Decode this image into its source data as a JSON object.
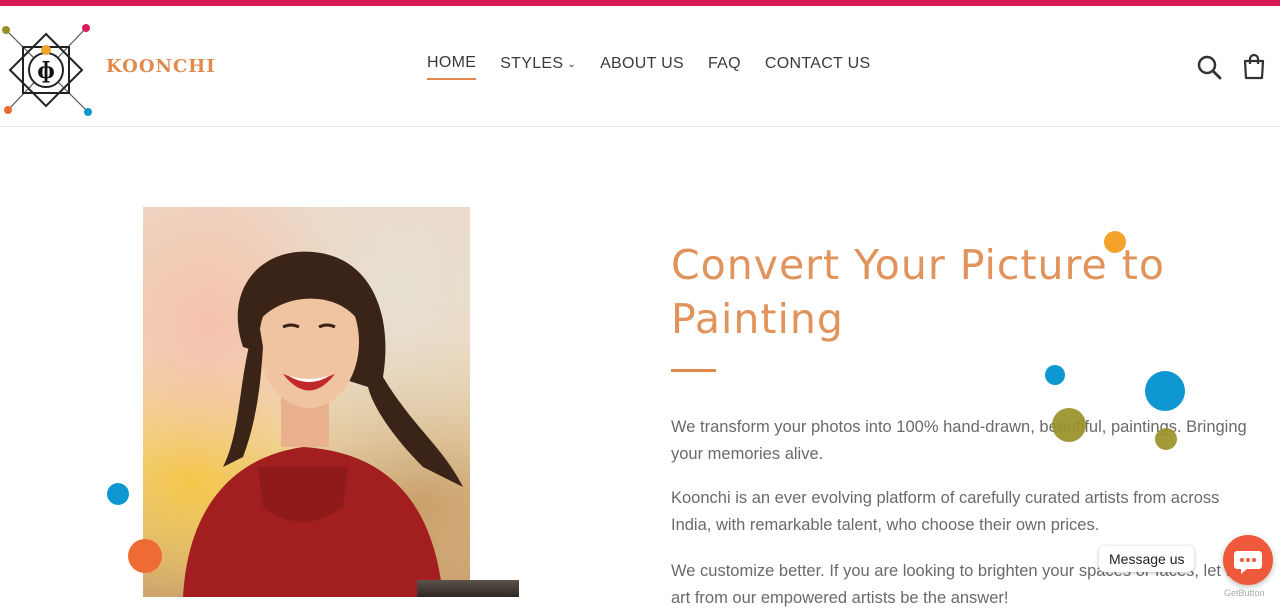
{
  "brand": {
    "name": "KOONCHI",
    "accent": "#e08a4e",
    "topbar_color": "#d81b55"
  },
  "nav": [
    {
      "label": "HOME",
      "active": true
    },
    {
      "label": "STYLES",
      "dropdown": true
    },
    {
      "label": "ABOUT US"
    },
    {
      "label": "FAQ"
    },
    {
      "label": "CONTACT US"
    }
  ],
  "header_icons": [
    "search-icon",
    "cart-icon"
  ],
  "hero": {
    "title": "Convert Your Picture to Painting",
    "paragraphs": [
      "We transform your photos into 100% hand-drawn, beautiful, paintings. Bringing your memories alive.",
      "Koonchi is an ever evolving platform of carefully curated artists from across India, with remarkable talent, who choose their own prices.",
      "We customize better. If you are looking to brighten your spaces or faces, let the art from our empowered artists be the answer!"
    ]
  },
  "chat": {
    "message_label": "Message us",
    "badge": "GetButton",
    "color": "#f05a3c"
  },
  "decor_colors": {
    "orange": "#f3a32a",
    "blue": "#0e97d1",
    "olive": "#9a9027",
    "coral": "#ee6b35"
  }
}
